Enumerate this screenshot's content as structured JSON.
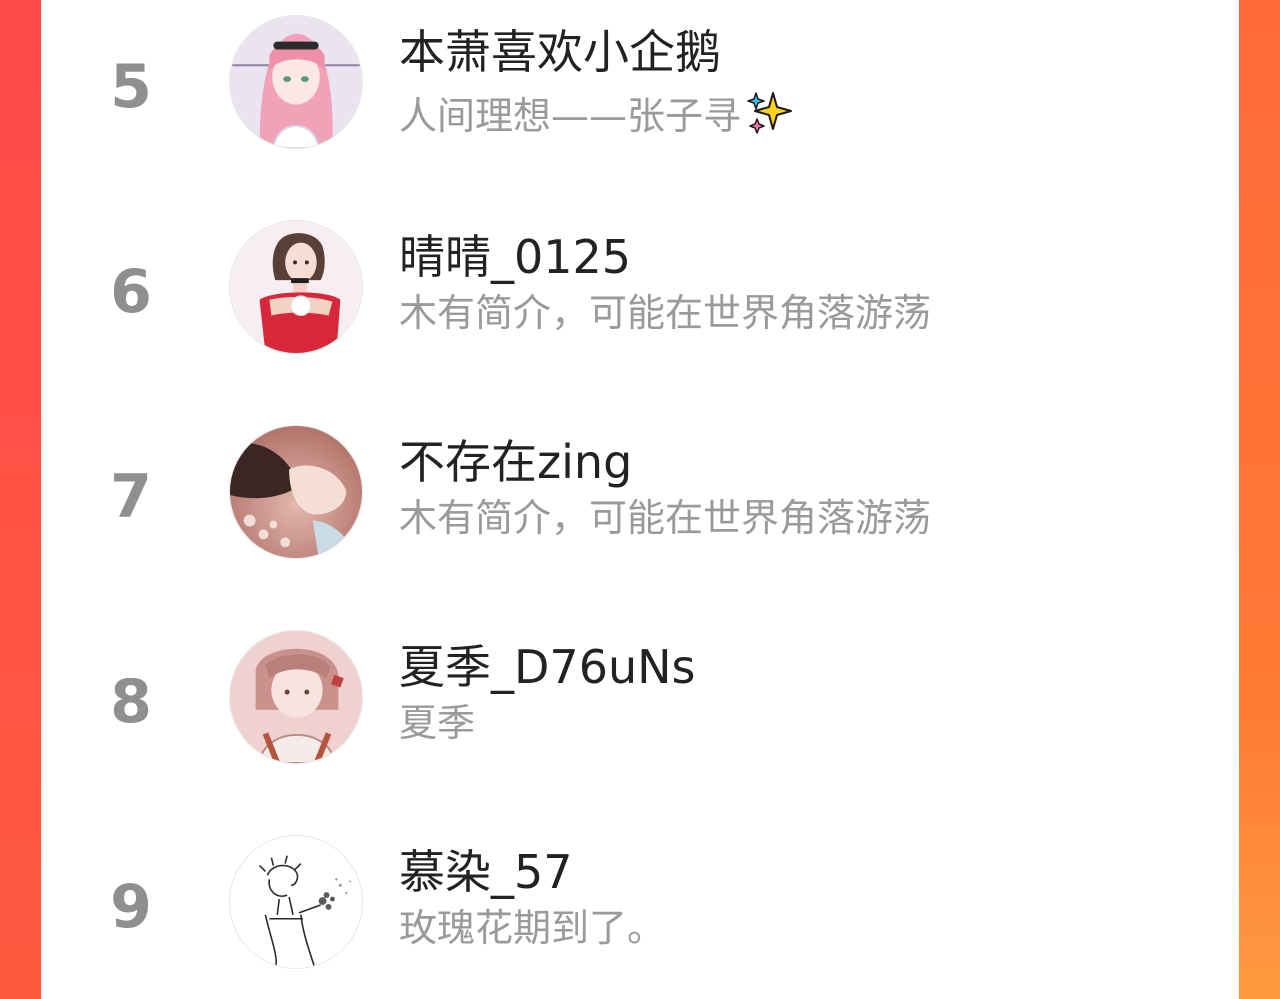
{
  "list": {
    "items": [
      {
        "rank": "5",
        "name": "本萧喜欢小企鹅",
        "bio": "人间理想——张子寻",
        "bio_emoji": "sparkles-icon",
        "avatar": "anime-girl-pink-hair-avatar"
      },
      {
        "rank": "6",
        "name": "晴晴_0125",
        "bio": "木有简介，可能在世界角落游荡",
        "avatar": "illustrated-girl-red-dress-avatar"
      },
      {
        "rank": "7",
        "name": "不存在zing",
        "bio": "木有简介，可能在世界角落游荡",
        "avatar": "girl-profile-flowers-avatar"
      },
      {
        "rank": "8",
        "name": "夏季_D76uNs",
        "bio": "夏季",
        "avatar": "anime-girl-braid-avatar"
      },
      {
        "rank": "9",
        "name": "慕染_57",
        "bio": "玫瑰花期到了。",
        "avatar": "sketch-boy-flowers-avatar"
      }
    ]
  },
  "colors": {
    "accent_left": "#ff4a4a",
    "accent_right": "#ff7a34",
    "rank": "#8f8f8f",
    "name": "#222222",
    "bio": "#9a9a9a"
  }
}
